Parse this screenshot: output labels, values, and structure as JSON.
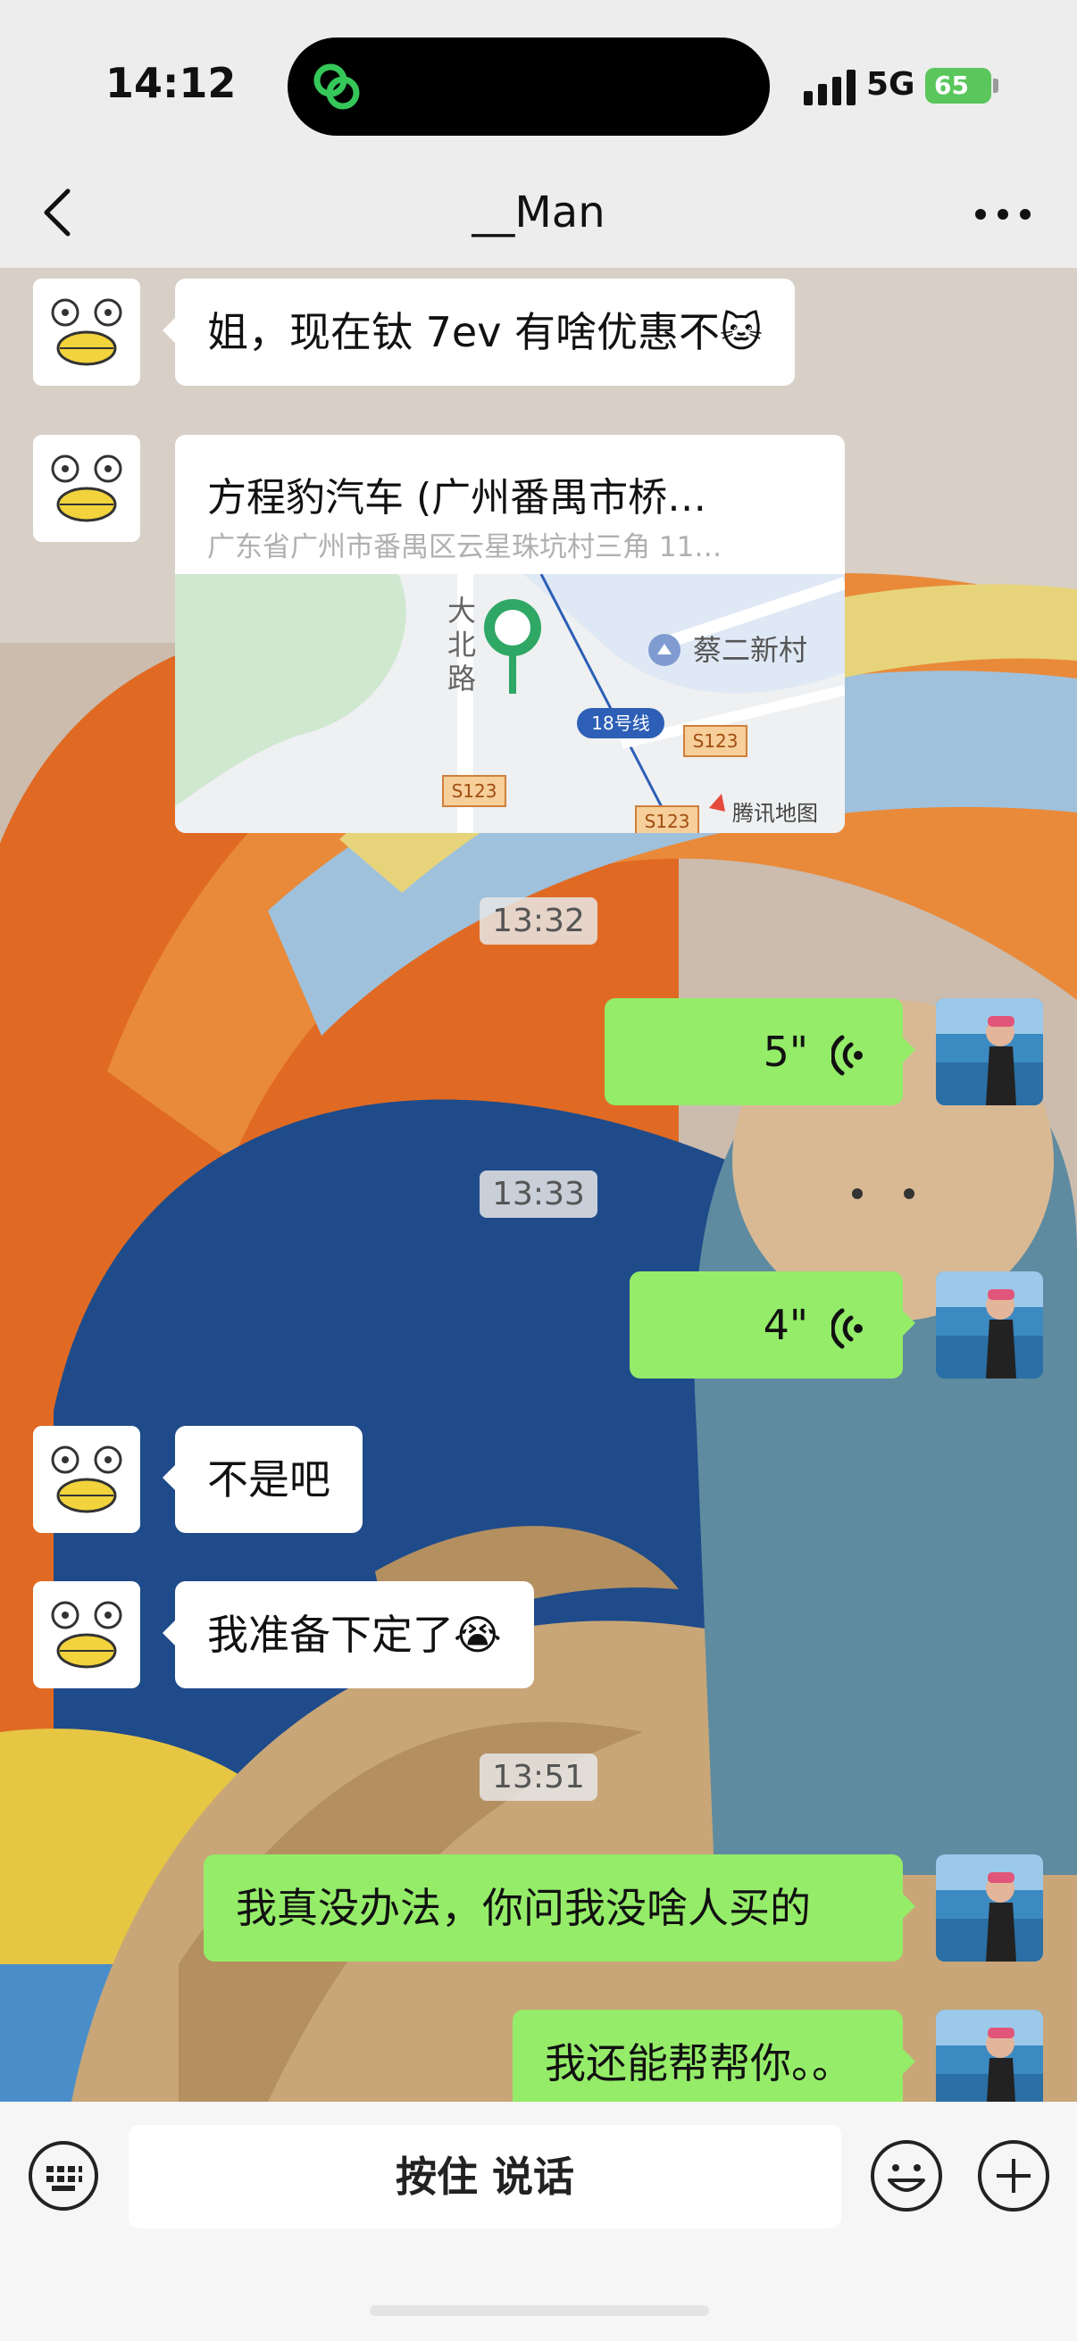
{
  "status_bar": {
    "time": "14:12",
    "network": "5G",
    "battery": "65"
  },
  "nav": {
    "title": "__Man"
  },
  "messages": {
    "m1": "姐，现在钛 7ev 有啥优惠不🐱",
    "location": {
      "title": "方程豹汽车 (广州番禺市桥…",
      "address": "广东省广州市番禺区云星珠坑村三角 11…",
      "map_labels": {
        "village": "蔡二新村",
        "road_1": "大",
        "road_2": "北",
        "road_3": "路",
        "metro": "18号线",
        "highway": "S123",
        "provider": "腾讯地图"
      }
    },
    "ts1": "13:32",
    "voice1": "5\"",
    "ts2": "13:33",
    "voice2": "4\"",
    "m2": "不是吧",
    "m3": "我准备下定了😭",
    "ts3": "13:51",
    "m4": "我真没办法，你问我没啥人买的",
    "m5": "我还能帮帮你。。"
  },
  "input_bar": {
    "hold_to_talk": "按住 说话"
  },
  "colors": {
    "outgoing_bubble": "#95ec69",
    "incoming_bubble": "#ffffff",
    "battery": "#5ac65c"
  }
}
